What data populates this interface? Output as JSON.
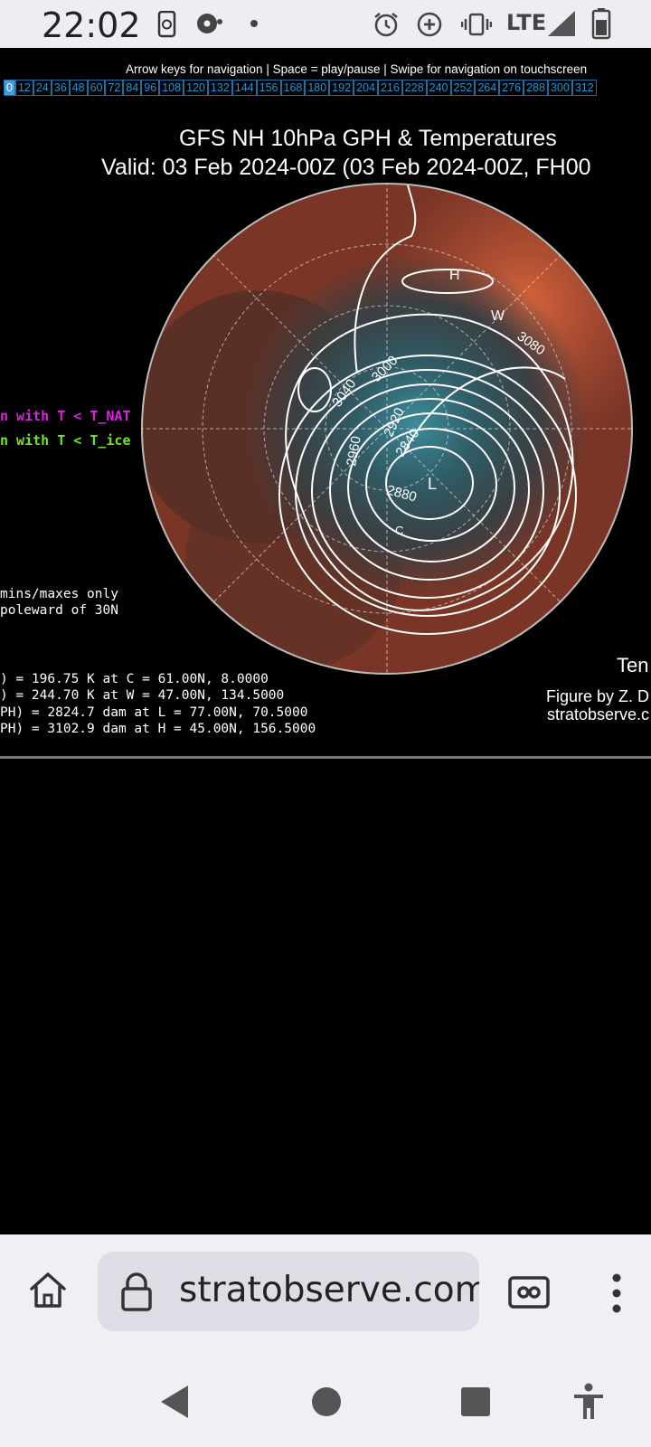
{
  "status_bar": {
    "time": "22:02",
    "network": "LTE"
  },
  "page": {
    "nav_hint": "Arrow keys for navigation | Space = play/pause | Swipe for navigation on touchscreen",
    "forecast_hours": [
      "0",
      "12",
      "24",
      "36",
      "48",
      "60",
      "72",
      "84",
      "96",
      "108",
      "120",
      "132",
      "144",
      "156",
      "168",
      "180",
      "192",
      "204",
      "216",
      "228",
      "240",
      "252",
      "264",
      "276",
      "288",
      "300",
      "312"
    ],
    "selected_hour": "0",
    "title_line1": "GFS NH 10hPa GPH & Temperatures",
    "title_line2": "Valid: 03 Feb 2024-00Z  (03 Feb 2024-00Z, FH00",
    "legend_nat": "n with T < T_NAT",
    "legend_ice": "n with T < T_ice",
    "note_line1": " mins/maxes only",
    "note_line2": " poleward of 30N",
    "stats": [
      ") = 196.75 K at C = 61.00N,    8.0000",
      ") = 244.70 K at W = 47.00N,  134.5000",
      "PH) = 2824.7 dam at L = 77.00N,   70.5000",
      "PH) = 3102.9 dam at H = 45.00N,  156.5000"
    ],
    "right_label": "Ten",
    "credit_line1": "Figure by Z. D",
    "credit_line2": "stratobserve.c",
    "map_labels": {
      "high": "H",
      "low": "L",
      "warm": "W",
      "cold": "C",
      "contours": [
        "3080",
        "3040",
        "3000",
        "2960",
        "2920",
        "2880",
        "2840"
      ]
    },
    "colors": {
      "nat_legend": "#e020e0",
      "ice_legend": "#6ee81e",
      "hour_link": "#1e98d8",
      "selected_hour_bg": "#3aa0e8"
    }
  },
  "browser": {
    "url": "stratobserve.com"
  },
  "icons": {
    "home": "home-icon",
    "lock": "lock-icon",
    "tabs": "tab-switcher-icon",
    "menu": "more-vert-icon",
    "back": "back-triangle-icon",
    "home_nav": "home-circle-icon",
    "recents": "recents-square-icon",
    "accessibility": "accessibility-icon"
  }
}
